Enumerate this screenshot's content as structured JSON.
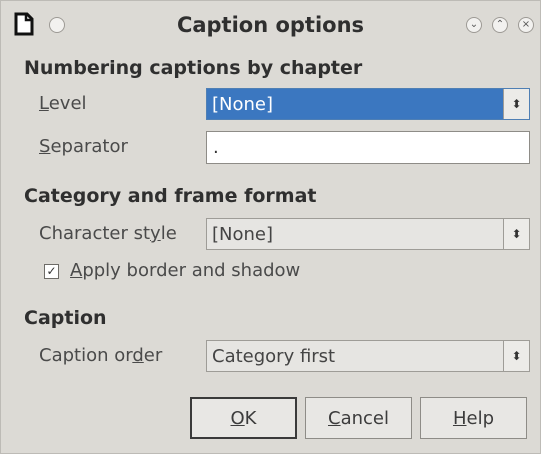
{
  "window": {
    "title": "Caption options"
  },
  "numbering": {
    "heading": "Numbering captions by chapter",
    "level_label_u": "L",
    "level_label_rest": "evel",
    "level_value": "[None]",
    "separator_label_u": "S",
    "separator_label_rest": "eparator",
    "separator_value": "."
  },
  "category": {
    "heading": "Category and frame format",
    "char_style_label_pre": "Character st",
    "char_style_label_u": "y",
    "char_style_label_post": "le",
    "char_style_value": "[None]",
    "apply_border_checked_glyph": "☑",
    "apply_border_u": "A",
    "apply_border_rest": "pply border and shadow"
  },
  "caption": {
    "heading": "Caption",
    "order_label_pre": "Caption or",
    "order_label_u": "d",
    "order_label_post": "er",
    "order_value": "Category first"
  },
  "buttons": {
    "ok_u": "O",
    "ok_rest": "K",
    "cancel_u": "C",
    "cancel_rest": "ancel",
    "help_u": "H",
    "help_rest": "elp"
  },
  "icons": {
    "spin": "⬍",
    "menu": "○",
    "minimize": "⌄",
    "maximize": "⌃",
    "close": "×"
  },
  "colors": {
    "dialog_bg": "#dcdad5",
    "selection": "#3b77c0"
  }
}
